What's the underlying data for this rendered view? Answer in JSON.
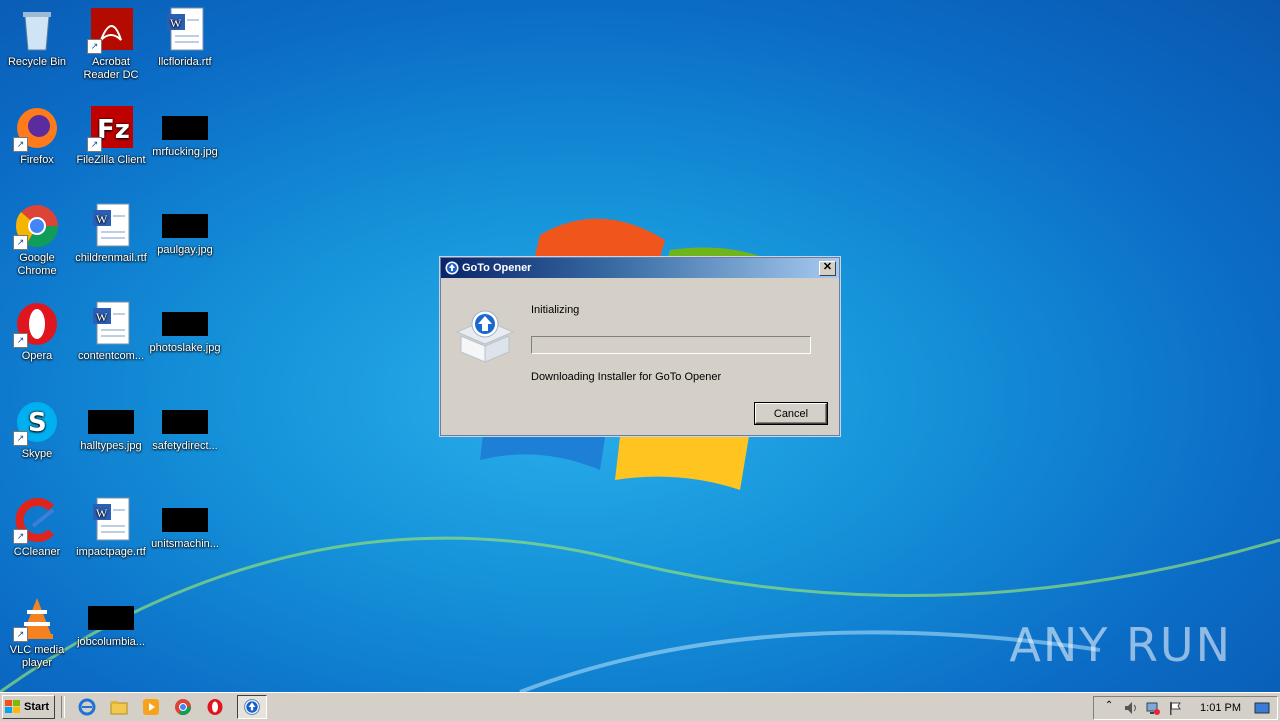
{
  "desktop_icons": [
    {
      "label": "Recycle Bin"
    },
    {
      "label": "Acrobat Reader DC"
    },
    {
      "label": "llcflorida.rtf"
    },
    {
      "label": "Firefox"
    },
    {
      "label": "FileZilla Client"
    },
    {
      "label": "mrfucking.jpg"
    },
    {
      "label": "Google Chrome"
    },
    {
      "label": "childrenmail.rtf"
    },
    {
      "label": "paulgay.jpg"
    },
    {
      "label": "Opera"
    },
    {
      "label": "contentcom..."
    },
    {
      "label": "photoslake.jpg"
    },
    {
      "label": "Skype"
    },
    {
      "label": "halltypes.jpg"
    },
    {
      "label": "safetydirect..."
    },
    {
      "label": "CCleaner"
    },
    {
      "label": "impactpage.rtf"
    },
    {
      "label": "unitsmachin..."
    },
    {
      "label": "VLC media player"
    },
    {
      "label": "jobcolumbia..."
    }
  ],
  "dialog": {
    "title": "GoTo Opener",
    "close_label": "✕",
    "status": "Initializing",
    "progress": 0,
    "detail": "Downloading Installer for GoTo Opener",
    "cancel_label": "Cancel"
  },
  "taskbar": {
    "start_label": "Start",
    "clock": "1:01 PM"
  },
  "watermark": "ANY RUN"
}
